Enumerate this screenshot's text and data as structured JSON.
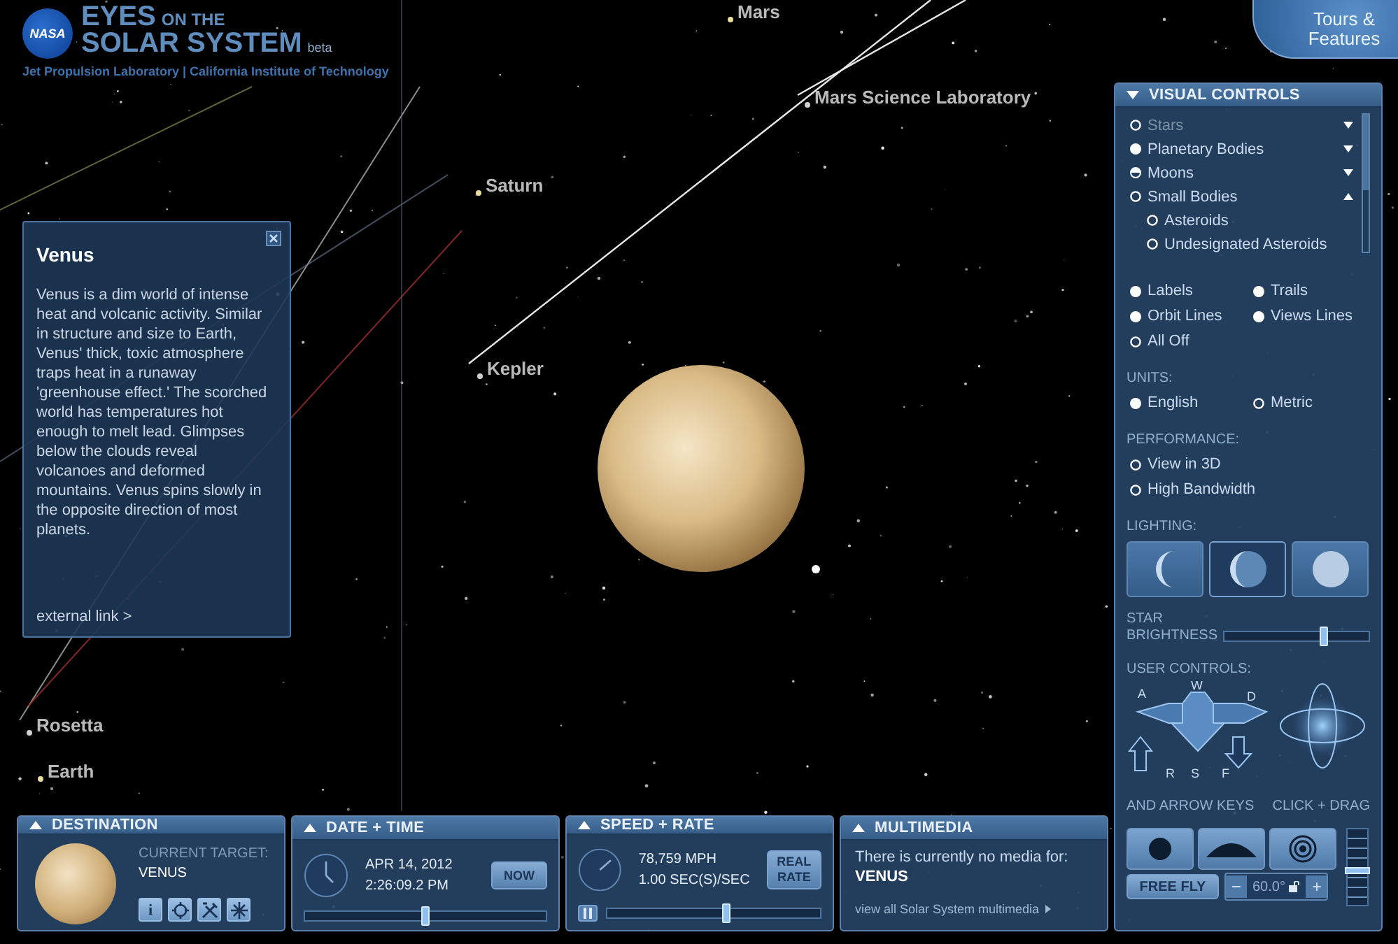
{
  "header": {
    "logo_badge": "NASA",
    "title_eyes": "EYES",
    "title_on_the": "ON THE",
    "title_solar": "SOLAR SYSTEM",
    "beta": "beta",
    "subtitle": "Jet Propulsion Laboratory | California Institute of Technology"
  },
  "tours_button": {
    "label": "Tours & Features"
  },
  "scene": {
    "labels": [
      {
        "text": "Mars",
        "kind": "body"
      },
      {
        "text": "Mars Science Laboratory",
        "kind": "spacecraft"
      },
      {
        "text": "Saturn",
        "kind": "body"
      },
      {
        "text": "Kepler",
        "kind": "spacecraft"
      },
      {
        "text": "Rosetta",
        "kind": "spacecraft"
      },
      {
        "text": "Earth",
        "kind": "body"
      }
    ]
  },
  "info_card": {
    "title": "Venus",
    "body": "Venus is a dim world of intense heat and volcanic activity. Similar in structure and size to Earth, Venus' thick, toxic atmosphere traps heat in a runaway 'greenhouse effect.' The scorched world has temperatures hot enough to melt lead. Glimpses below the clouds reveal volcanoes and deformed mountains. Venus spins slowly in the opposite direction of most planets.",
    "link": "external link >"
  },
  "visual_controls": {
    "title": "VISUAL CONTROLS",
    "layers": [
      {
        "label": "Stars",
        "checked": false,
        "mixed": false,
        "disabled": true,
        "expanded": false
      },
      {
        "label": "Planetary Bodies",
        "checked": true,
        "mixed": false,
        "disabled": false,
        "expanded": false
      },
      {
        "label": "Moons",
        "checked": false,
        "mixed": true,
        "disabled": false,
        "expanded": false
      },
      {
        "label": "Small Bodies",
        "checked": false,
        "mixed": false,
        "disabled": false,
        "expanded": true,
        "children": [
          {
            "label": "Asteroids",
            "checked": false,
            "disabled": false
          },
          {
            "label": "Undesignated Asteroids",
            "checked": false,
            "disabled": false
          }
        ]
      }
    ],
    "toggles": [
      {
        "label": "Labels",
        "checked": true
      },
      {
        "label": "Trails",
        "checked": true
      },
      {
        "label": "Orbit Lines",
        "checked": true
      },
      {
        "label": "Views Lines",
        "checked": true
      },
      {
        "label": "All Off",
        "checked": false
      }
    ],
    "units": {
      "label": "UNITS:",
      "options": [
        {
          "label": "English",
          "selected": true
        },
        {
          "label": "Metric",
          "selected": false
        }
      ]
    },
    "performance": {
      "label": "PERFORMANCE:",
      "options": [
        {
          "label": "View in 3D",
          "checked": false
        },
        {
          "label": "High Bandwidth",
          "checked": false
        }
      ]
    },
    "lighting": {
      "label": "LIGHTING:",
      "options": [
        {
          "kind": "crescent",
          "selected": false
        },
        {
          "kind": "half",
          "selected": true
        },
        {
          "kind": "full",
          "selected": false
        }
      ]
    },
    "star_brightness": {
      "label": "STAR BRIGHTNESS",
      "level": 0.69
    },
    "user_controls": {
      "label": "USER CONTROLS:",
      "keys": [
        "A",
        "W",
        "D",
        "R",
        "S",
        "F"
      ],
      "keys_caption": "AND ARROW KEYS",
      "drag_caption": "CLICK + DRAG"
    },
    "view_buttons": [
      {
        "kind": "dot"
      },
      {
        "kind": "horizon"
      },
      {
        "kind": "target"
      }
    ],
    "free_fly": "FREE FLY",
    "field_of_view": {
      "minus": "−",
      "value": "60.0°",
      "plus": "+"
    },
    "zoom": {
      "level": 0.45
    }
  },
  "bottom_panels": {
    "destination": {
      "title": "DESTINATION",
      "target_label": "CURRENT TARGET:",
      "target": "VENUS",
      "tools": [
        {
          "kind": "info",
          "label": "i"
        },
        {
          "kind": "target"
        },
        {
          "kind": "tools"
        },
        {
          "kind": "asterisk"
        }
      ]
    },
    "date_time": {
      "title": "DATE + TIME",
      "date": "APR 14, 2012",
      "time": "2:26:09.2 PM",
      "now_button": "NOW",
      "level": 0.5
    },
    "speed_rate": {
      "title": "SPEED + RATE",
      "speed": "78,759 MPH",
      "rate": "1.00 SEC(S)/SEC",
      "real_rate_button": "REAL RATE",
      "paused": false,
      "level": 0.56
    },
    "multimedia": {
      "title": "MULTIMEDIA",
      "message": "There is currently no media for:",
      "target": "VENUS",
      "link": "view all Solar System multimedia"
    }
  }
}
